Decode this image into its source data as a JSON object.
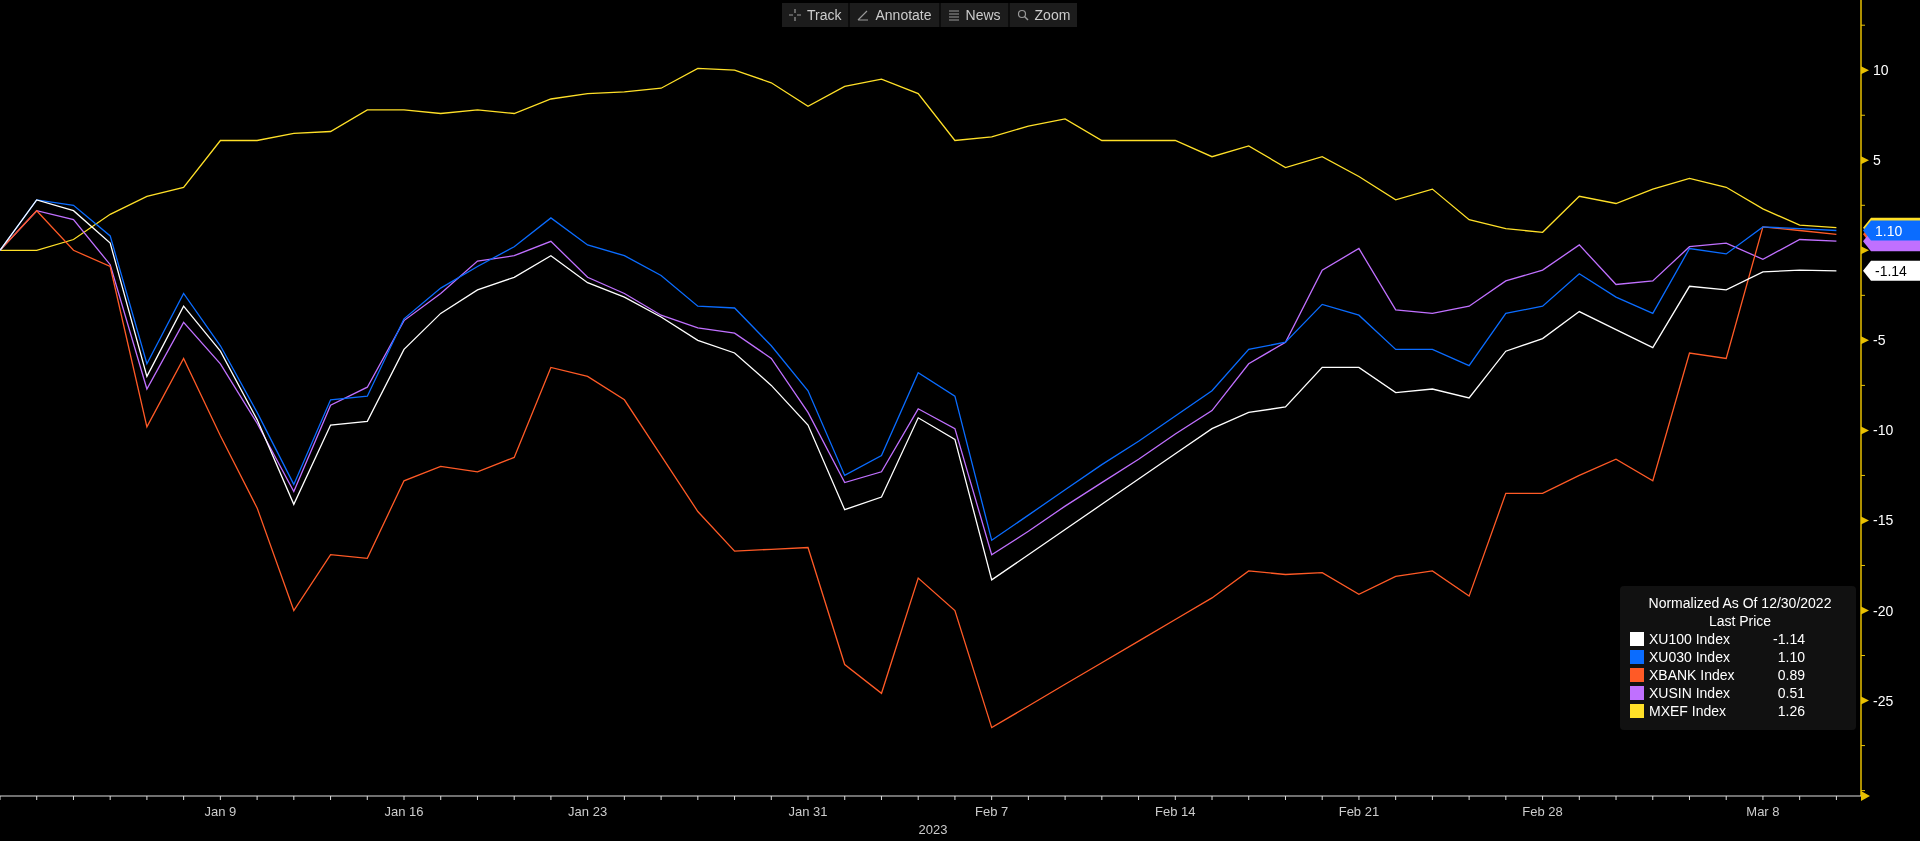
{
  "toolbar": [
    {
      "kind": "track",
      "label": "Track"
    },
    {
      "kind": "annotate",
      "label": "Annotate"
    },
    {
      "kind": "news",
      "label": "News"
    },
    {
      "kind": "zoom",
      "label": "Zoom"
    }
  ],
  "chart": {
    "chart_data": {
      "type": "line",
      "xlabel": "2023",
      "categories": [
        null,
        null,
        null,
        null,
        null,
        null,
        "Jan 9",
        null,
        null,
        null,
        null,
        "Jan 16",
        null,
        null,
        null,
        null,
        "Jan 23",
        null,
        null,
        null,
        null,
        null,
        "Jan 31",
        null,
        null,
        null,
        null,
        "Feb 7",
        null,
        null,
        null,
        null,
        "Feb 14",
        null,
        null,
        null,
        null,
        "Feb 21",
        null,
        null,
        null,
        null,
        "Feb 28",
        null,
        null,
        null,
        null,
        null,
        "Mar 8",
        null,
        null
      ],
      "legend": {
        "title": "Normalized As Of 12/30/2022",
        "subtitle": "Last Price",
        "last_prices": [
          "-1.14",
          "1.10",
          "0.89",
          "0.51",
          "1.26"
        ]
      },
      "series": [
        {
          "name": "XU100 Index",
          "color": "#ffffff",
          "values": [
            0,
            2.8,
            2.2,
            0.4,
            -7,
            -3.1,
            -5.6,
            -9.4,
            -14.1,
            -9.7,
            -9.5,
            -5.5,
            -3.5,
            -2.2,
            -1.5,
            -0.3,
            -1.8,
            -2.6,
            -3.7,
            -5,
            -5.7,
            -7.5,
            -9.7,
            -14.4,
            -13.7,
            -9.3,
            -10.5,
            -18.3,
            -16.9,
            -15.5,
            -14.1,
            -12.7,
            -11.3,
            -9.9,
            -9,
            -8.7,
            -6.5,
            -6.5,
            -7.9,
            -7.7,
            -8.2,
            -5.6,
            -4.9,
            -3.4,
            -4.4,
            -5.4,
            -2,
            -2.2,
            -1.2,
            -1.1,
            -1.14
          ]
        },
        {
          "name": "XU030 Index",
          "color": "#0a6cff",
          "values": [
            0,
            2.8,
            2.5,
            0.8,
            -6.3,
            -2.4,
            -5.3,
            -9,
            -13,
            -8.3,
            -8.1,
            -3.8,
            -2.1,
            -0.9,
            0.2,
            1.8,
            0.3,
            -0.3,
            -1.4,
            -3.1,
            -3.2,
            -5.3,
            -7.8,
            -12.5,
            -11.4,
            -6.8,
            -8.1,
            -16.1,
            -14.7,
            -13.3,
            -11.9,
            -10.6,
            -9.2,
            -7.8,
            -5.5,
            -5.1,
            -3,
            -3.6,
            -5.5,
            -5.5,
            -6.4,
            -3.5,
            -3.1,
            -1.3,
            -2.6,
            -3.5,
            0.1,
            -0.2,
            1.3,
            1.2,
            1.1
          ]
        },
        {
          "name": "XBANK Index",
          "color": "#ff5a26",
          "values": [
            0,
            2.2,
            0,
            -0.9,
            -9.8,
            -6,
            -10.3,
            -14.3,
            -20,
            -16.9,
            -17.1,
            -12.8,
            -12,
            -12.3,
            -11.5,
            -6.5,
            -7,
            -8.3,
            -11.4,
            -14.5,
            -16.7,
            -16.6,
            -16.5,
            -23,
            -24.6,
            -18.2,
            -20,
            -26.5,
            -25.3,
            -24.1,
            -22.9,
            -21.7,
            -20.5,
            -19.3,
            -17.8,
            -18,
            -17.9,
            -19.1,
            -18.1,
            -17.8,
            -19.2,
            -13.5,
            -13.5,
            -12.5,
            -11.6,
            -12.8,
            -5.7,
            -6,
            1.3,
            1.1,
            0.89
          ]
        },
        {
          "name": "XUSIN Index",
          "color": "#c070ff",
          "values": [
            0,
            2.2,
            1.7,
            -0.8,
            -7.7,
            -4,
            -6.3,
            -9.6,
            -13.4,
            -8.6,
            -7.6,
            -3.9,
            -2.4,
            -0.6,
            -0.3,
            0.5,
            -1.5,
            -2.4,
            -3.6,
            -4.3,
            -4.6,
            -6,
            -9,
            -12.9,
            -12.3,
            -8.8,
            -9.9,
            -16.9,
            -15.6,
            -14.2,
            -12.9,
            -11.6,
            -10.2,
            -8.9,
            -6.3,
            -5.1,
            -1.1,
            0.1,
            -3.3,
            -3.5,
            -3.1,
            -1.7,
            -1.1,
            0.3,
            -1.9,
            -1.7,
            0.2,
            0.4,
            -0.5,
            0.6,
            0.51
          ]
        },
        {
          "name": "MXEF Index",
          "color": "#ffe028",
          "values": [
            0,
            0,
            0.6,
            2,
            3,
            3.5,
            6.1,
            6.1,
            6.5,
            6.6,
            7.8,
            7.8,
            7.6,
            7.8,
            7.6,
            8.4,
            8.7,
            8.8,
            9,
            10.1,
            10,
            9.3,
            8,
            9.1,
            9.5,
            8.7,
            6.1,
            6.3,
            6.9,
            7.3,
            6.1,
            6.1,
            6.1,
            5.2,
            5.8,
            4.6,
            5.2,
            4.1,
            2.8,
            3.4,
            1.7,
            1.2,
            1,
            3,
            2.6,
            3.4,
            4,
            3.5,
            2.3,
            1.4,
            1.26
          ]
        }
      ],
      "ylim": [
        -30.3,
        13.9
      ],
      "yticks": [
        10,
        5,
        -5,
        -10,
        -15,
        -20,
        -25
      ]
    },
    "price_tags": [
      {
        "text": "1.10",
        "color": "#0a6cff"
      },
      {
        "text": "-1.14",
        "color": "#ffffff"
      }
    ]
  }
}
